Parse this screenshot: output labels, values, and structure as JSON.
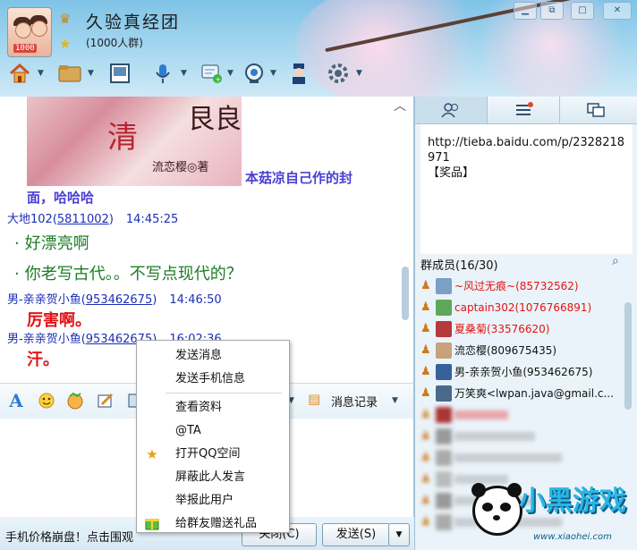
{
  "window": {
    "group_name": "久验真经团",
    "group_sub": "(1000人群)",
    "avatar_badge": "1000",
    "controls": [
      "minimize",
      "restore",
      "maximize",
      "close"
    ]
  },
  "toolbar": {
    "icons": [
      "home-icon",
      "folder-icon",
      "album-icon",
      "microphone-icon",
      "share-icon",
      "webcam-icon",
      "police-icon",
      "settings-icon"
    ]
  },
  "chat": {
    "book_cover": {
      "title_char": "清",
      "title_big": "艮良",
      "author": "流恋樱◎著"
    },
    "caption": "本菇凉自己作的封",
    "caption_cont": "面，哈哈哈",
    "messages": [
      {
        "sender": "大地102",
        "id": "5811002",
        "time": "14:45:25",
        "lines": [
          "好漂亮啊",
          "你老写古代。。不写点现代的？"
        ],
        "style": "green"
      },
      {
        "sender": "男-亲亲贺小鱼",
        "id": "953462675",
        "time": "14:46:50",
        "lines": [
          "厉害啊。"
        ],
        "style": "red"
      },
      {
        "sender": "男-亲亲贺小鱼",
        "id": "953462675",
        "time": "16:02:36",
        "lines": [
          "汗。"
        ],
        "style": "red"
      }
    ]
  },
  "input_toolbar": {
    "icons": [
      "font-icon",
      "emoji-icon",
      "magic-emoji-icon",
      "edit-icon",
      "image-icon",
      "dropdown-icon"
    ],
    "record_label": "消息记录"
  },
  "bottom": {
    "ad_text": "手机价格崩盘！点击围观",
    "close_label": "关闭(C)",
    "send_label": "发送(S)"
  },
  "context_menu": {
    "items": [
      {
        "label": "发送消息",
        "icon": ""
      },
      {
        "label": "发送手机信息",
        "icon": ""
      },
      {
        "label": "查看资料",
        "icon": ""
      },
      {
        "label": "@TA",
        "icon": ""
      },
      {
        "label": "打开QQ空间",
        "icon": "star-icon"
      },
      {
        "label": "屏蔽此人发言",
        "icon": ""
      },
      {
        "label": "举报此用户",
        "icon": ""
      },
      {
        "label": "给群友赠送礼品",
        "icon": "gift-icon"
      }
    ]
  },
  "right_panel": {
    "tabs": [
      "members-tab",
      "list-tab",
      "window-tab"
    ],
    "notice": "http://tieba.baidu.com/p/2328218971\n【奖品】",
    "members_title": "群成员(16/30)",
    "members": [
      {
        "name": "~风过无痕~(85732562)",
        "color": "#e11414",
        "blur": false
      },
      {
        "name": "captain302(1076766891)",
        "color": "#e11414",
        "blur": false
      },
      {
        "name": "夏桑菊(33576620)",
        "color": "#e11414",
        "blur": false
      },
      {
        "name": "流恋樱(809675435)",
        "color": "#111111",
        "blur": false
      },
      {
        "name": "男-亲亲贺小鱼(953462675)",
        "color": "#111111",
        "blur": false
      },
      {
        "name": "万笑爽<lwpan.java@gmail.c...",
        "color": "#111111",
        "blur": false
      },
      {
        "name": "",
        "color": "#e11414",
        "blur": true
      },
      {
        "name": "",
        "color": "#888888",
        "blur": true
      },
      {
        "name": "",
        "color": "#888888",
        "blur": true
      },
      {
        "name": "",
        "color": "#888888",
        "blur": true
      },
      {
        "name": "",
        "color": "#888888",
        "blur": true
      },
      {
        "name": "",
        "color": "#888888",
        "blur": true
      }
    ]
  },
  "watermark": {
    "text": "小黑游戏",
    "url": "www.xiaohei.com"
  }
}
